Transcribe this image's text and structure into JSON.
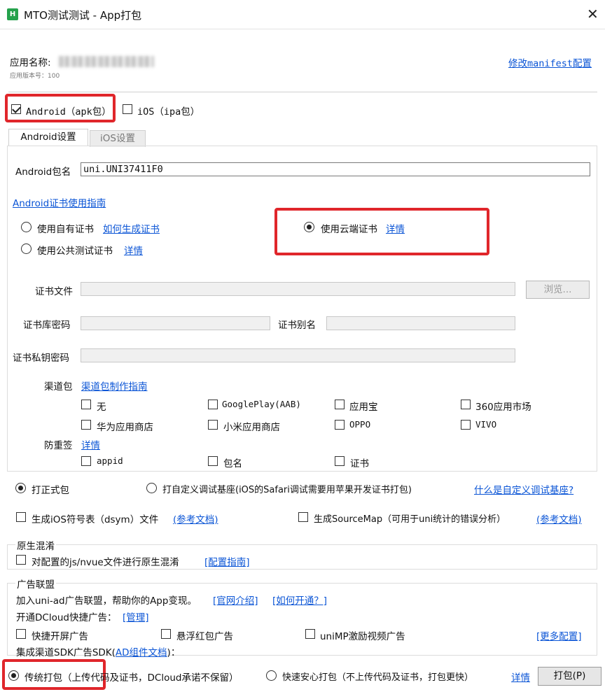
{
  "window": {
    "title": "MTO测试测试 - App打包",
    "logo_text": "H",
    "close_glyph": "✕"
  },
  "header": {
    "app_name_label": "应用名称:",
    "version_label": "应用版本号：100",
    "edit_manifest_link": "修改manifest配置"
  },
  "platforms": {
    "android_label": "Android（apk包）",
    "android_checked": true,
    "ios_label": "iOS（ipa包）",
    "ios_checked": false
  },
  "tabs": {
    "android": "Android设置",
    "ios": "iOS设置"
  },
  "android": {
    "package_label": "Android包名",
    "package_value": "uni.UNI37411F0",
    "cert_guide_link": "Android证书使用指南",
    "own_cert_label": "使用自有证书",
    "how_generate_link": "如何生成证书",
    "public_cert_label": "使用公共测试证书",
    "public_details_link": "详情",
    "cloud_cert_label": "使用云端证书",
    "cloud_details_link": "详情",
    "cert_file_label": "证书文件",
    "browse_button": "浏览...",
    "keystore_pwd_label": "证书库密码",
    "alias_label": "证书别名",
    "key_pwd_label": "证书私钥密码",
    "channel_label": "渠道包",
    "channel_guide_link": "渠道包制作指南",
    "channels": [
      "无",
      "GooglePlay(AAB)",
      "应用宝",
      "360应用市场",
      "华为应用商店",
      "小米应用商店",
      "OPPO",
      "VIVO"
    ],
    "anti_tamper_label": "防重签",
    "anti_tamper_link": "详情",
    "anti_tamper_items": [
      "appid",
      "包名",
      "证书"
    ]
  },
  "build_type": {
    "release_label": "打正式包",
    "custom_base_label": "打自定义调试基座(iOS的Safari调试需要用苹果开发证书打包)",
    "what_is_link": "什么是自定义调试基座?"
  },
  "symbols": {
    "ios_dsym_label": "生成iOS符号表（dsym）文件",
    "ios_dsym_link": "(参考文档)",
    "sourcemap_label": "生成SourceMap（可用于uni统计的错误分析）",
    "sourcemap_link": "(参考文档)"
  },
  "obfuscation": {
    "title": "原生混淆",
    "option_label": "对配置的js/nvue文件进行原生混淆",
    "guide_link": "[配置指南]"
  },
  "ads": {
    "title": "广告联盟",
    "intro_text": "加入uni-ad广告联盟，帮助你的App变现。",
    "official_link": "[官网介绍]",
    "how_open_link": "[如何开通？]",
    "quick_ads_label": "开通DCloud快捷广告：",
    "manage_link": "[管理]",
    "splash_label": "快捷开屏广告",
    "floating_label": "悬浮红包广告",
    "reward_label": "uniMP激励视频广告",
    "more_link": "[更多配置]",
    "sdk_label_prefix": "集成渠道SDK广告SDK(",
    "sdk_link": "AD组件文档",
    "sdk_label_suffix": ")："
  },
  "footer": {
    "traditional_label": "传统打包（上传代码及证书，DCloud承诺不保留）",
    "fast_label": "快速安心打包（不上传代码及证书，打包更快）",
    "details_link": "详情",
    "pack_button": "打包(P)"
  }
}
